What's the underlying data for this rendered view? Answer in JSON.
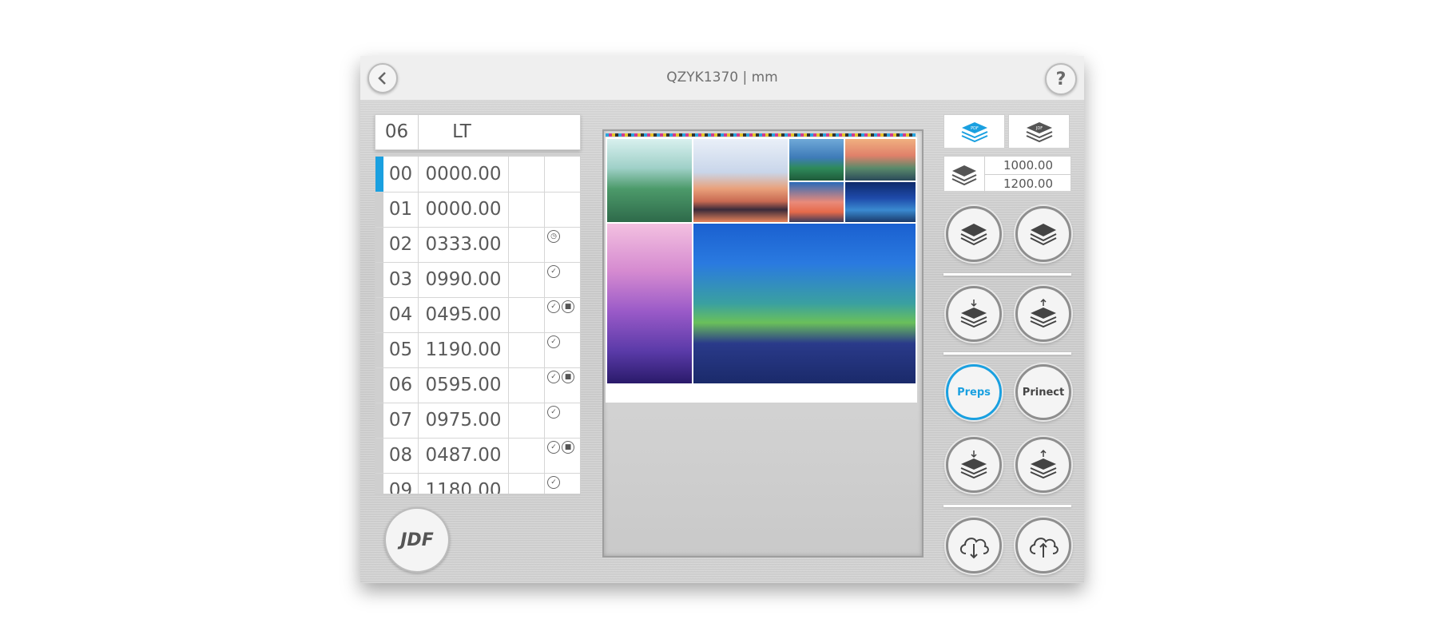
{
  "header": {
    "title": "QZYK1370 | mm",
    "help_label": "?"
  },
  "list_header": {
    "number": "06",
    "label": "LT"
  },
  "list_rows": [
    {
      "idx": "00",
      "value": "0000.00",
      "icons": []
    },
    {
      "idx": "01",
      "value": "0000.00",
      "icons": []
    },
    {
      "idx": "02",
      "value": "0333.00",
      "icons": [
        "timer-icon"
      ]
    },
    {
      "idx": "03",
      "value": "0990.00",
      "icons": [
        "check-search-icon"
      ]
    },
    {
      "idx": "04",
      "value": "0495.00",
      "icons": [
        "check-search-icon",
        "stop-search-icon"
      ]
    },
    {
      "idx": "05",
      "value": "1190.00",
      "icons": [
        "check-search-icon"
      ]
    },
    {
      "idx": "06",
      "value": "0595.00",
      "icons": [
        "check-search-icon",
        "stop-search-icon"
      ]
    },
    {
      "idx": "07",
      "value": "0975.00",
      "icons": [
        "check-search-icon"
      ]
    },
    {
      "idx": "08",
      "value": "0487.00",
      "icons": [
        "check-search-icon",
        "stop-search-icon"
      ]
    },
    {
      "idx": "09",
      "value": "1180.00",
      "icons": [
        "check-search-icon"
      ]
    }
  ],
  "tabs": {
    "pdf_label": "PDF",
    "jdf_label": "JDF"
  },
  "size": {
    "width": "1000.00",
    "height": "1200.00"
  },
  "buttons": {
    "preps_label": "Preps",
    "prinect_label": "Prinect",
    "jdf_logo": "JDF"
  },
  "colors": {
    "accent": "#1aa0e0",
    "panel": "#d0d0d0"
  }
}
